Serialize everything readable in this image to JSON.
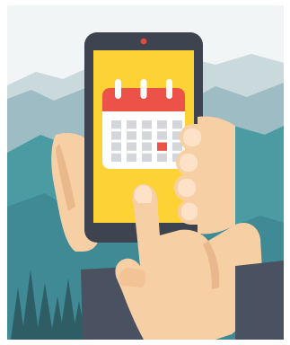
{
  "illustration": {
    "subject": "smartphone-calendar-app",
    "colors": {
      "sky": "#f1f5f5",
      "mountain_far": "#c9d9dc",
      "mountain_mid": "#9dbcc4",
      "mountain_front": "#3f8a95",
      "mountain_teal": "#4b9ba3",
      "trees": "#2f5d66",
      "phone_body": "#3d4450",
      "phone_screen": "#fdd235",
      "camera_dot": "#e24b3c",
      "calendar_header": "#ec5247",
      "calendar_body": "#ffffff",
      "calendar_ring": "#ffffff",
      "calendar_cell": "#d3d7dc",
      "calendar_cell_selected": "#ec5247",
      "skin": "#f7cfa4",
      "skin_shadow": "#e9b98c",
      "sleeve": "#4a5160"
    },
    "calendar": {
      "rows": 4,
      "columns": 5,
      "selected_row": 2,
      "selected_column": 3
    }
  }
}
